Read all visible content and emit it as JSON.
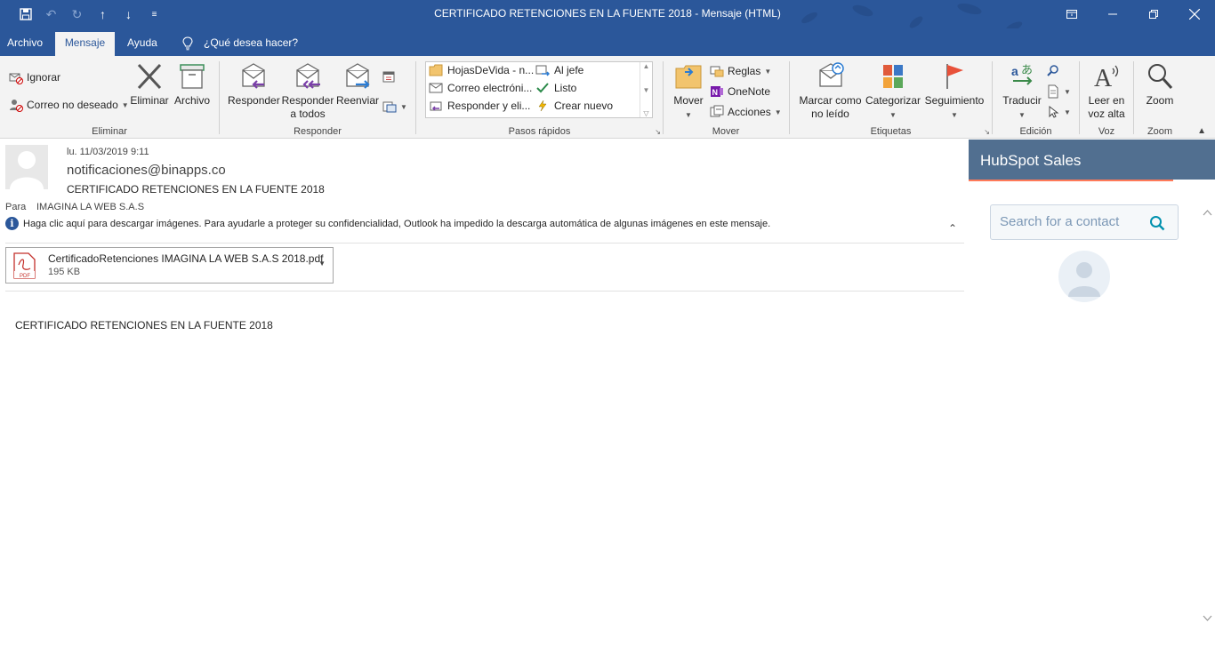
{
  "window": {
    "title": "CERTIFICADO RETENCIONES EN LA FUENTE 2018  -  Mensaje (HTML)",
    "qat_icons": [
      "save-icon",
      "undo-icon",
      "redo-icon",
      "up-arrow-icon",
      "down-arrow-icon",
      "customize-qat-icon"
    ],
    "controls": [
      "ribbon-display-icon",
      "minimize-icon",
      "restore-icon",
      "close-icon"
    ]
  },
  "tabs": [
    {
      "label": "Archivo",
      "active": false
    },
    {
      "label": "Mensaje",
      "active": true
    },
    {
      "label": "Ayuda",
      "active": false
    }
  ],
  "tell_me": "¿Qué desea hacer?",
  "ribbon": {
    "eliminar": {
      "label": "Eliminar",
      "ignorar": "Ignorar",
      "correo_no_deseado": "Correo no deseado",
      "eliminar_btn": "Eliminar",
      "archivo_btn": "Archivo"
    },
    "responder": {
      "label": "Responder",
      "responder": "Responder",
      "responder_todos_1": "Responder",
      "responder_todos_2": "a todos",
      "reenviar": "Reenviar"
    },
    "pasos_rapidos": {
      "label": "Pasos rápidos",
      "items": [
        "HojasDeVida - n...",
        "Correo electróni...",
        "Responder y eli...",
        "Al jefe",
        "Listo",
        "Crear nuevo"
      ]
    },
    "mover": {
      "label": "Mover",
      "mover": "Mover",
      "reglas": "Reglas",
      "onenote": "OneNote",
      "acciones": "Acciones"
    },
    "etiquetas": {
      "label": "Etiquetas",
      "marcar_1": "Marcar como",
      "marcar_2": "no leído",
      "categorizar": "Categorizar",
      "seguimiento": "Seguimiento"
    },
    "edicion": {
      "label": "Edición",
      "traducir": "Traducir"
    },
    "voz": {
      "label": "Voz",
      "leer_1": "Leer en",
      "leer_2": "voz alta"
    },
    "zoom": {
      "label": "Zoom",
      "zoom": "Zoom"
    }
  },
  "message": {
    "date": "lu. 11/03/2019 9:11",
    "from": "notificaciones@binapps.co",
    "subject": "CERTIFICADO RETENCIONES EN LA FUENTE 2018",
    "to_label": "Para",
    "to": "IMAGINA LA WEB S.A.S",
    "info": "Haga clic aquí para descargar imágenes. Para ayudarle a proteger su confidencialidad, Outlook ha impedido la descarga automática de algunas imágenes en este mensaje.",
    "attachment": {
      "name": "CertificadoRetenciones IMAGINA LA WEB S.A.S 2018.pdf",
      "size": "195 KB",
      "type_label": "PDF"
    },
    "body": "CERTIFICADO RETENCIONES EN LA FUENTE 2018"
  },
  "hubspot": {
    "title": "HubSpot Sales",
    "search_placeholder": "Search for a contact",
    "accent": "#ff7a59",
    "header_color": "#516f90"
  },
  "colors": {
    "titlebar": "#2b579a",
    "ribbon": "#f3f3f3"
  }
}
